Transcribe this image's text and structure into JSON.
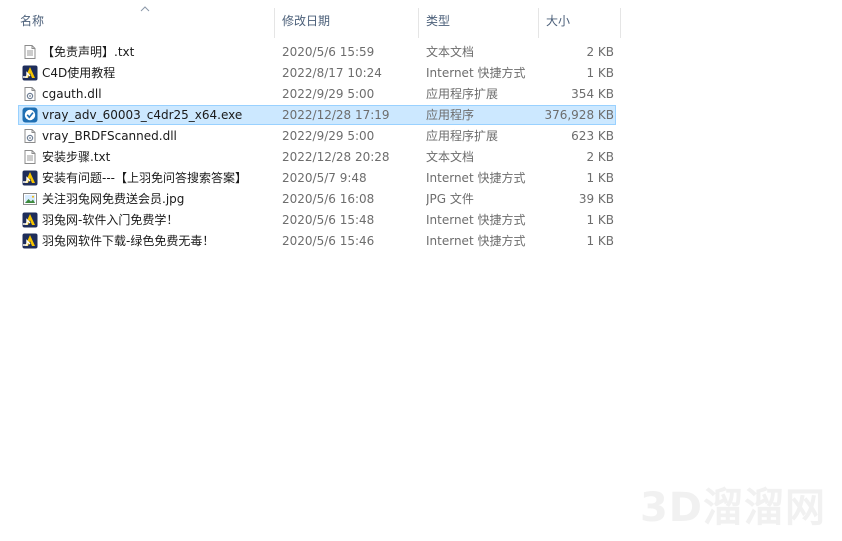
{
  "columns": {
    "name": "名称",
    "date": "修改日期",
    "type": "类型",
    "size": "大小"
  },
  "files": [
    {
      "name": "【免责声明】.txt",
      "date": "2020/5/6 15:59",
      "type": "文本文档",
      "size": "2 KB",
      "icon": "text-file-icon",
      "selected": false
    },
    {
      "name": "C4D使用教程",
      "date": "2022/8/17 10:24",
      "type": "Internet 快捷方式",
      "size": "1 KB",
      "icon": "internet-shortcut-icon",
      "selected": false
    },
    {
      "name": "cgauth.dll",
      "date": "2022/9/29 5:00",
      "type": "应用程序扩展",
      "size": "354 KB",
      "icon": "dll-file-icon",
      "selected": false
    },
    {
      "name": "vray_adv_60003_c4dr25_x64.exe",
      "date": "2022/12/28 17:19",
      "type": "应用程序",
      "size": "376,928 KB",
      "icon": "vray-installer-icon",
      "selected": true
    },
    {
      "name": "vray_BRDFScanned.dll",
      "date": "2022/9/29 5:00",
      "type": "应用程序扩展",
      "size": "623 KB",
      "icon": "dll-file-icon",
      "selected": false
    },
    {
      "name": "安装步骤.txt",
      "date": "2022/12/28 20:28",
      "type": "文本文档",
      "size": "2 KB",
      "icon": "text-file-icon",
      "selected": false
    },
    {
      "name": "安装有问题---【上羽免问答搜索答案】",
      "date": "2020/5/7 9:48",
      "type": "Internet 快捷方式",
      "size": "1 KB",
      "icon": "internet-shortcut-icon",
      "selected": false
    },
    {
      "name": "关注羽兔网免费送会员.jpg",
      "date": "2020/5/6 16:08",
      "type": "JPG 文件",
      "size": "39 KB",
      "icon": "image-file-icon",
      "selected": false
    },
    {
      "name": "羽兔网-软件入门免费学！",
      "date": "2020/5/6 15:48",
      "type": "Internet 快捷方式",
      "size": "1 KB",
      "icon": "internet-shortcut-icon",
      "selected": false
    },
    {
      "name": "羽兔网软件下载-绿色免费无毒！",
      "date": "2020/5/6 15:46",
      "type": "Internet 快捷方式",
      "size": "1 KB",
      "icon": "internet-shortcut-icon",
      "selected": false
    }
  ],
  "watermark": "3D溜溜网",
  "colors": {
    "selection_bg": "#cce8ff",
    "selection_border": "#99d1ff",
    "header_text": "#4c607a",
    "secondary_text": "#6d6d6d"
  }
}
